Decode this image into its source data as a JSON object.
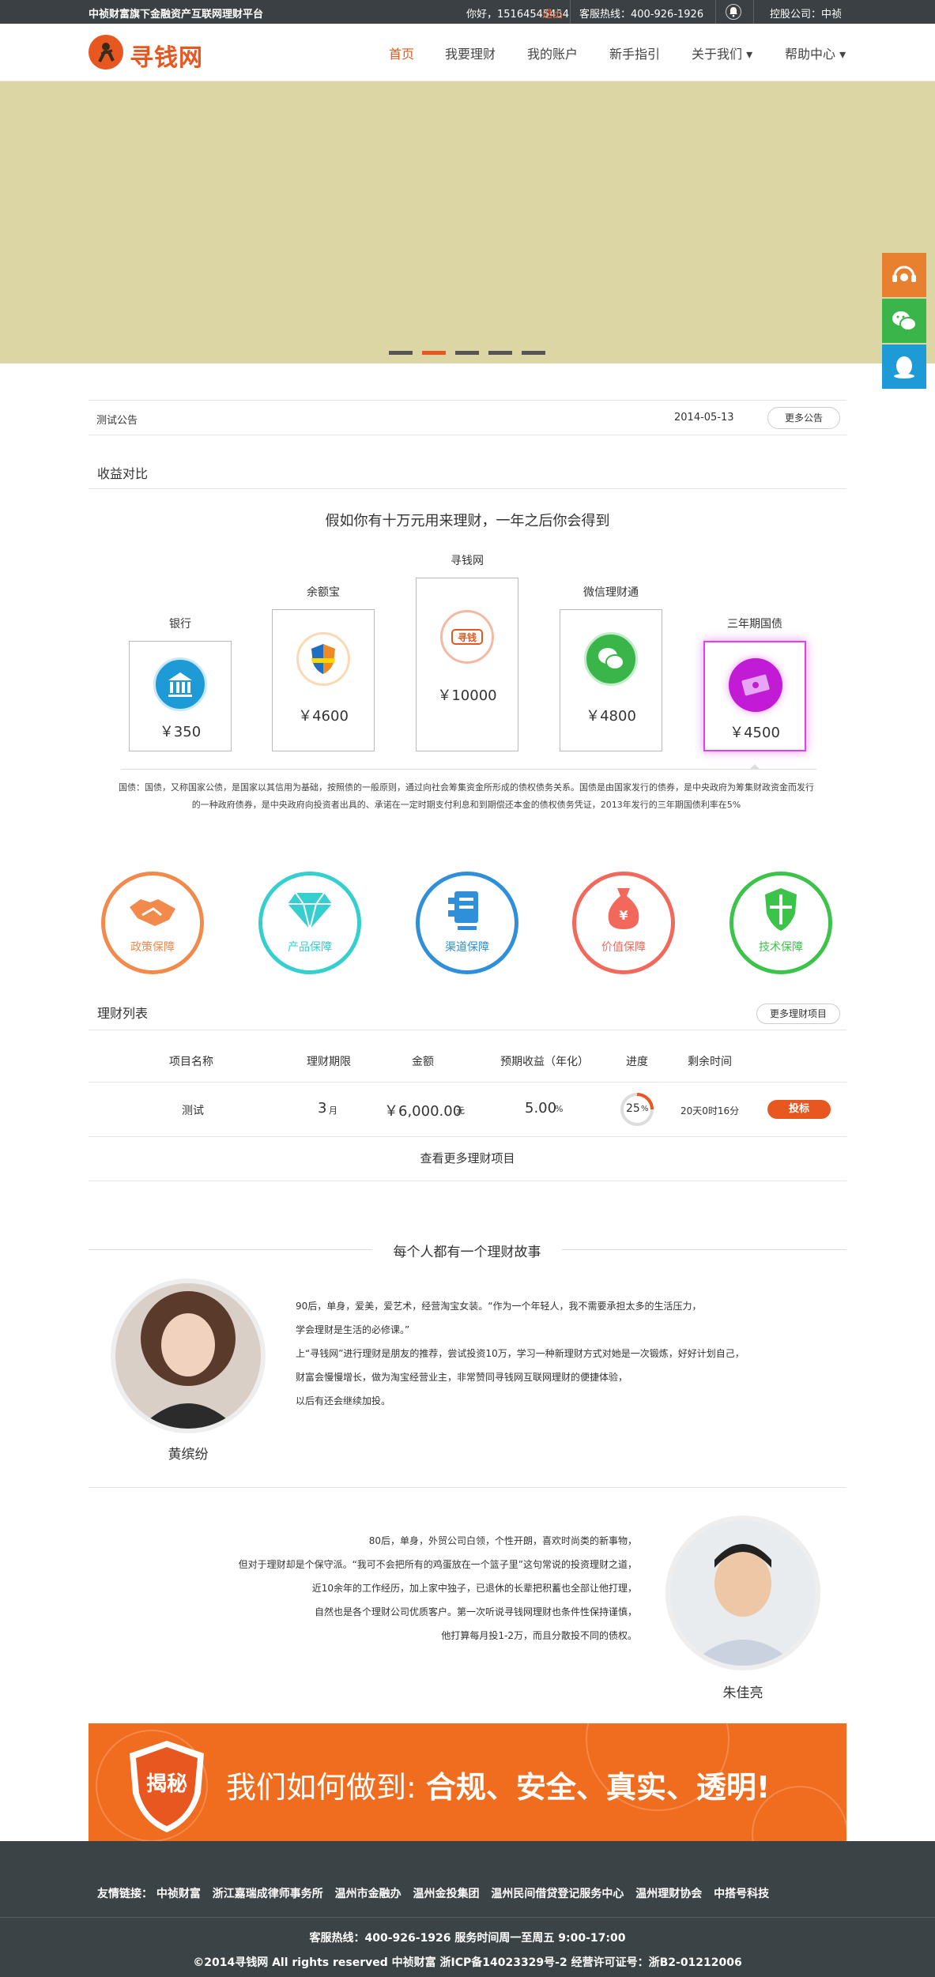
{
  "topbar": {
    "slogan": "中祯财富旗下金融资产互联网理财平台",
    "greeting": "你好，15164545454",
    "logout": "退出",
    "hotline": "客服热线：400-926-1926",
    "holding": "控股公司：中祯"
  },
  "header": {
    "logo_text": "寻钱网",
    "nav": [
      "首页",
      "我要理财",
      "我的账户",
      "新手指引",
      "关于我们 ▾",
      "帮助中心 ▾"
    ]
  },
  "notice": {
    "title": "测试公告",
    "date": "2014-05-13",
    "more": "更多公告"
  },
  "compare": {
    "section_title": "收益对比",
    "headline": "假如你有十万元用来理财，一年之后你会得到",
    "cards": [
      {
        "label": "银行",
        "value": "￥350",
        "icon": "bank-icon",
        "color": "#1e9bd7"
      },
      {
        "label": "余额宝",
        "value": "￥4600",
        "icon": "shield-icon",
        "color": "#f08a24"
      },
      {
        "label": "寻钱网",
        "value": "￥10000",
        "icon": "xunqian-icon",
        "color": "#e8571f"
      },
      {
        "label": "微信理财通",
        "value": "￥4800",
        "icon": "wechat-icon",
        "color": "#3ab54a"
      },
      {
        "label": "三年期国债",
        "value": "￥4500",
        "icon": "bond-icon",
        "color": "#c21bd6"
      }
    ],
    "note": "国债：国债，又称国家公债，是国家以其信用为基础，按照债的一般原则，通过向社会筹集资金所形成的债权债务关系。国债是由国家发行的债券，是中央政府为筹集财政资金而发行的一种政府债券，是中央政府向投资者出具的、承诺在一定时期支付利息和到期偿还本金的债权债务凭证，2013年发行的三年期国债利率在5%"
  },
  "features": [
    {
      "label": "政策保障",
      "icon": "handshake-icon",
      "color": "#f28a4b"
    },
    {
      "label": "产品保障",
      "icon": "diamond-icon",
      "color": "#35cfcf"
    },
    {
      "label": "渠道保障",
      "icon": "channel-icon",
      "color": "#2f8fd8"
    },
    {
      "label": "价值保障",
      "icon": "moneybag-icon",
      "color": "#f2695c"
    },
    {
      "label": "技术保障",
      "icon": "security-icon",
      "color": "#3bc34a"
    }
  ],
  "products": {
    "section_title": "理财列表",
    "more": "更多理财项目",
    "headers": [
      "项目名称",
      "理财期限",
      "金额",
      "预期收益（年化）",
      "进度",
      "剩余时间"
    ],
    "rows": [
      {
        "name": "测试",
        "term": "3",
        "term_unit": "月",
        "amount": "￥6,000.00",
        "amount_unit": "元",
        "rate": "5.00",
        "rate_unit": "%",
        "progress": "25",
        "progress_unit": "%",
        "remaining": "20天0时16分",
        "action": "投标"
      }
    ],
    "progress_fraction": 0.25,
    "view_more": "查看更多理财项目"
  },
  "stories": {
    "title": "每个人都有一个理财故事",
    "items": [
      {
        "name": "黄缤纷",
        "lines": [
          "90后，单身，爱美，爱艺术，经营淘宝女装。“作为一个年轻人，我不需要承担太多的生活压力，",
          "学会理财是生活的必修课。”",
          "上“寻钱网”进行理财是朋友的推荐，尝试投资10万，学习一种新理财方式对她是一次锻炼，好好计划自己，",
          "财富会慢慢增长，做为淘宝经营业主，非常赞同寻钱网互联网理财的便捷体验，",
          "以后有还会继续加投。"
        ]
      },
      {
        "name": "朱佳亮",
        "lines": [
          "80后，单身，外贸公司白领，个性开朗，喜欢时尚类的新事物，",
          "但对于理财却是个保守派。“我可不会把所有的鸡蛋放在一个篮子里”这句常说的投资理财之道，",
          "近10余年的工作经历，加上家中独子，已退休的长辈把积蓄也全部让他打理，",
          "自然也是各个理财公司优质客户。第一次听说寻钱网理财也条件性保持谨慎，",
          "他打算每月投1-2万，而且分散投不同的债权。"
        ]
      }
    ]
  },
  "promo": {
    "badge": "揭秘",
    "text_prefix": "我们如何做到: ",
    "text_bold": "合规、安全、真实、透明!"
  },
  "footer": {
    "links_label": "友情链接：",
    "links": [
      "中祯财富",
      "浙江嘉瑞成律师事务所",
      "温州市金融办",
      "温州金投集团",
      "温州民间借贷登记服务中心",
      "温州理财协会",
      "中搭号科技"
    ],
    "hotline": "客服热线：400-926-1926    服务时间周一至周五 9:00-17:00",
    "copyright": "©2014寻钱网  All rights reserved  中祯财富  浙ICP备14023329号-2  经营许可证号：浙B2-01212006"
  },
  "colors": {
    "brand": "#e8571f",
    "banner": "#dcd5a4",
    "footer": "#3c4346",
    "topbar": "#3a4043"
  }
}
